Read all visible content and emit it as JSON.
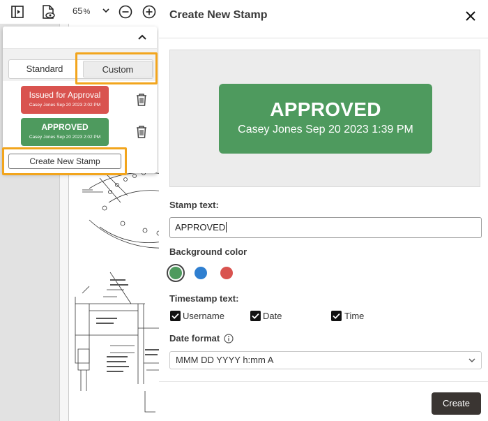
{
  "viewer": {
    "zoom_value": "65",
    "zoom_unit": "%"
  },
  "stamp_panel": {
    "tabs": [
      {
        "label": "Standard",
        "selected": false
      },
      {
        "label": "Custom",
        "selected": true
      }
    ],
    "stamps": [
      {
        "text": "Issued for Approval",
        "meta": "Casey Jones Sep 20 2023 2:02 PM",
        "color": "#d9534f"
      },
      {
        "text": "APPROVED",
        "meta": "Casey Jones Sep 20 2023 2:02 PM",
        "color": "#4e9a5e"
      }
    ],
    "create_button_label": "Create New Stamp",
    "highlight_color": "#f2a51d"
  },
  "dialog": {
    "title": "Create New Stamp",
    "preview": {
      "text": "APPROVED",
      "meta": "Casey Jones Sep 20 2023 1:39 PM"
    },
    "stamp_text_label": "Stamp text:",
    "stamp_text_value": "APPROVED",
    "background_color_label": "Background color",
    "colors": [
      {
        "name": "green",
        "hex": "#4e9a5e",
        "selected": true
      },
      {
        "name": "blue",
        "hex": "#2f7fd0",
        "selected": false
      },
      {
        "name": "red",
        "hex": "#d9534f",
        "selected": false
      }
    ],
    "timestamp_label": "Timestamp text:",
    "timestamp_options": [
      {
        "label": "Username",
        "checked": true
      },
      {
        "label": "Date",
        "checked": true
      },
      {
        "label": "Time",
        "checked": true
      }
    ],
    "date_format_label": "Date format",
    "date_format_value": "MMM DD YYYY h:mm A",
    "create_label": "Create"
  }
}
